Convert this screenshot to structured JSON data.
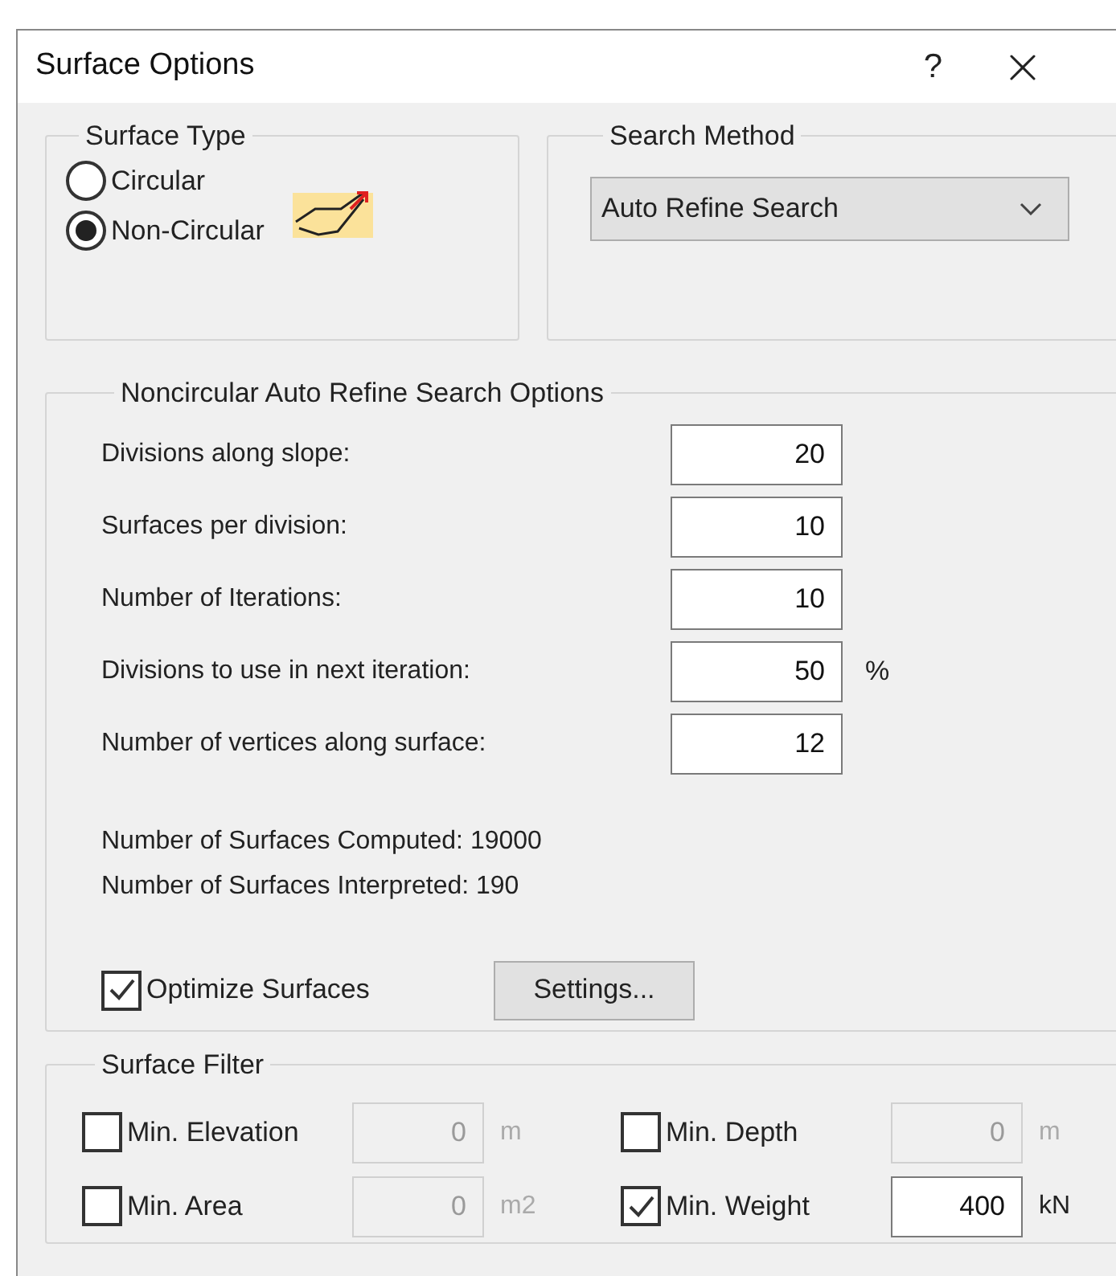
{
  "window": {
    "title": "Surface Options",
    "help": "?"
  },
  "surface_type": {
    "legend": "Surface Type",
    "options": [
      {
        "label": "Circular",
        "selected": false
      },
      {
        "label": "Non-Circular",
        "selected": true
      }
    ]
  },
  "search_method": {
    "legend": "Search Method",
    "value": "Auto Refine Search"
  },
  "noncircular": {
    "legend": "Noncircular Auto Refine Search Options",
    "fields": [
      {
        "label": "Divisions along slope:",
        "value": "20"
      },
      {
        "label": "Surfaces per division:",
        "value": "10"
      },
      {
        "label": "Number of Iterations:",
        "value": "10"
      },
      {
        "label": "Divisions to use in next iteration:",
        "value": "50",
        "unit": "%"
      },
      {
        "label": "Number of vertices along surface:",
        "value": "12"
      }
    ],
    "computed": "Number of Surfaces Computed: 19000",
    "interpreted": "Number of Surfaces Interpreted: 190",
    "optimize": {
      "label": "Optimize Surfaces",
      "checked": true
    },
    "settings_button": "Settings..."
  },
  "surface_filter": {
    "legend": "Surface Filter",
    "filters": [
      {
        "label": "Min. Elevation",
        "checked": false,
        "value": "0",
        "unit": "m"
      },
      {
        "label": "Min. Depth",
        "checked": false,
        "value": "0",
        "unit": "m"
      },
      {
        "label": "Min. Area",
        "checked": false,
        "value": "0",
        "unit": "m2"
      },
      {
        "label": "Min. Weight",
        "checked": true,
        "value": "400",
        "unit": "kN"
      }
    ]
  }
}
